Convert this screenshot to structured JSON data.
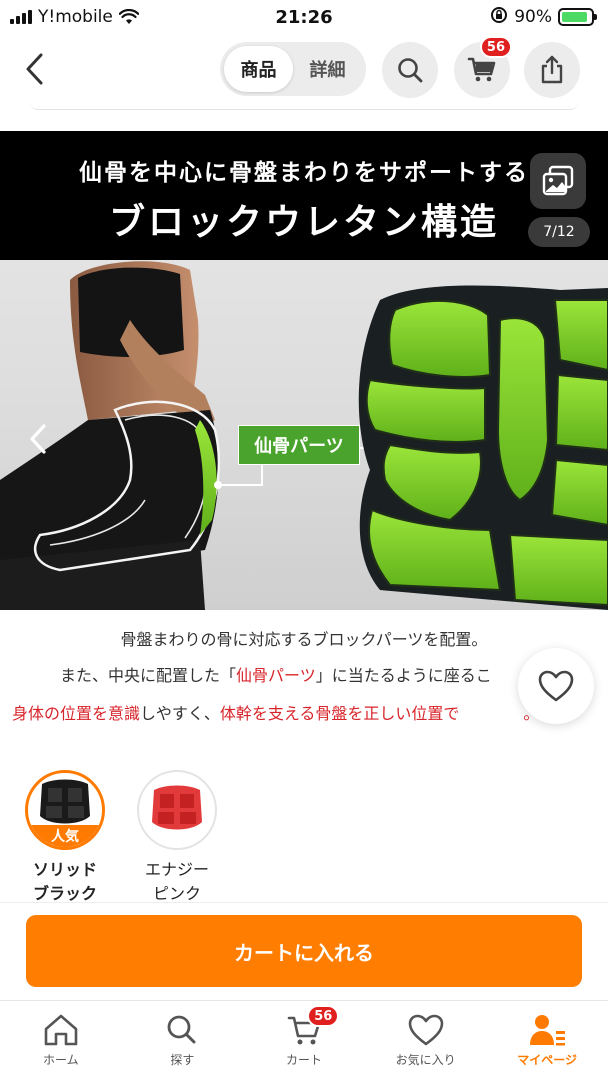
{
  "status_bar": {
    "carrier": "Y!mobile",
    "time": "21:26",
    "battery_percent": "90%",
    "battery_level": 0.9
  },
  "nav": {
    "back_icon": "chevron-left-icon",
    "segments": [
      "商品",
      "詳細"
    ],
    "active_segment": "商品",
    "cart_badge": "56"
  },
  "product_image": {
    "banner_line1": "仙骨を中心に骨盤まわりをサポートする",
    "banner_line2": "ブロックウレタン構造",
    "counter": "7/12",
    "callout_label": "仙骨パーツ",
    "colors": {
      "urethane_green": "#7ed321",
      "callout_green": "#49a32c"
    }
  },
  "description": {
    "line1": "骨盤まわりの骨に対応するブロックパーツを配置。",
    "line2_pre": "また、中央に配置した「",
    "line2_red": "仙骨パーツ",
    "line2_post": "」に当たるように座るこ",
    "line3_red1": "身体の位置を意識",
    "line3_mid": "しやすく、",
    "line3_red2": "体幹を支える骨盤を正しい位置で",
    "line3_tail": "。"
  },
  "variants": [
    {
      "name_line1": "ソリッド",
      "name_line2": "ブラック",
      "tag": "人気",
      "selected": true,
      "color": "#1a1a1a"
    },
    {
      "name_line1": "エナジー",
      "name_line2": "ピンク",
      "tag": "",
      "selected": false,
      "color": "#e23a3a"
    }
  ],
  "cta": {
    "label": "カートに入れる",
    "color": "#ff7d00"
  },
  "tab_bar": {
    "items": [
      {
        "label": "ホーム",
        "icon": "home-icon"
      },
      {
        "label": "探す",
        "icon": "search-icon"
      },
      {
        "label": "カート",
        "icon": "cart-icon",
        "badge": "56"
      },
      {
        "label": "お気に入り",
        "icon": "heart-icon"
      },
      {
        "label": "マイページ",
        "icon": "user-icon",
        "active": true
      }
    ],
    "accent": "#ff7a00"
  }
}
